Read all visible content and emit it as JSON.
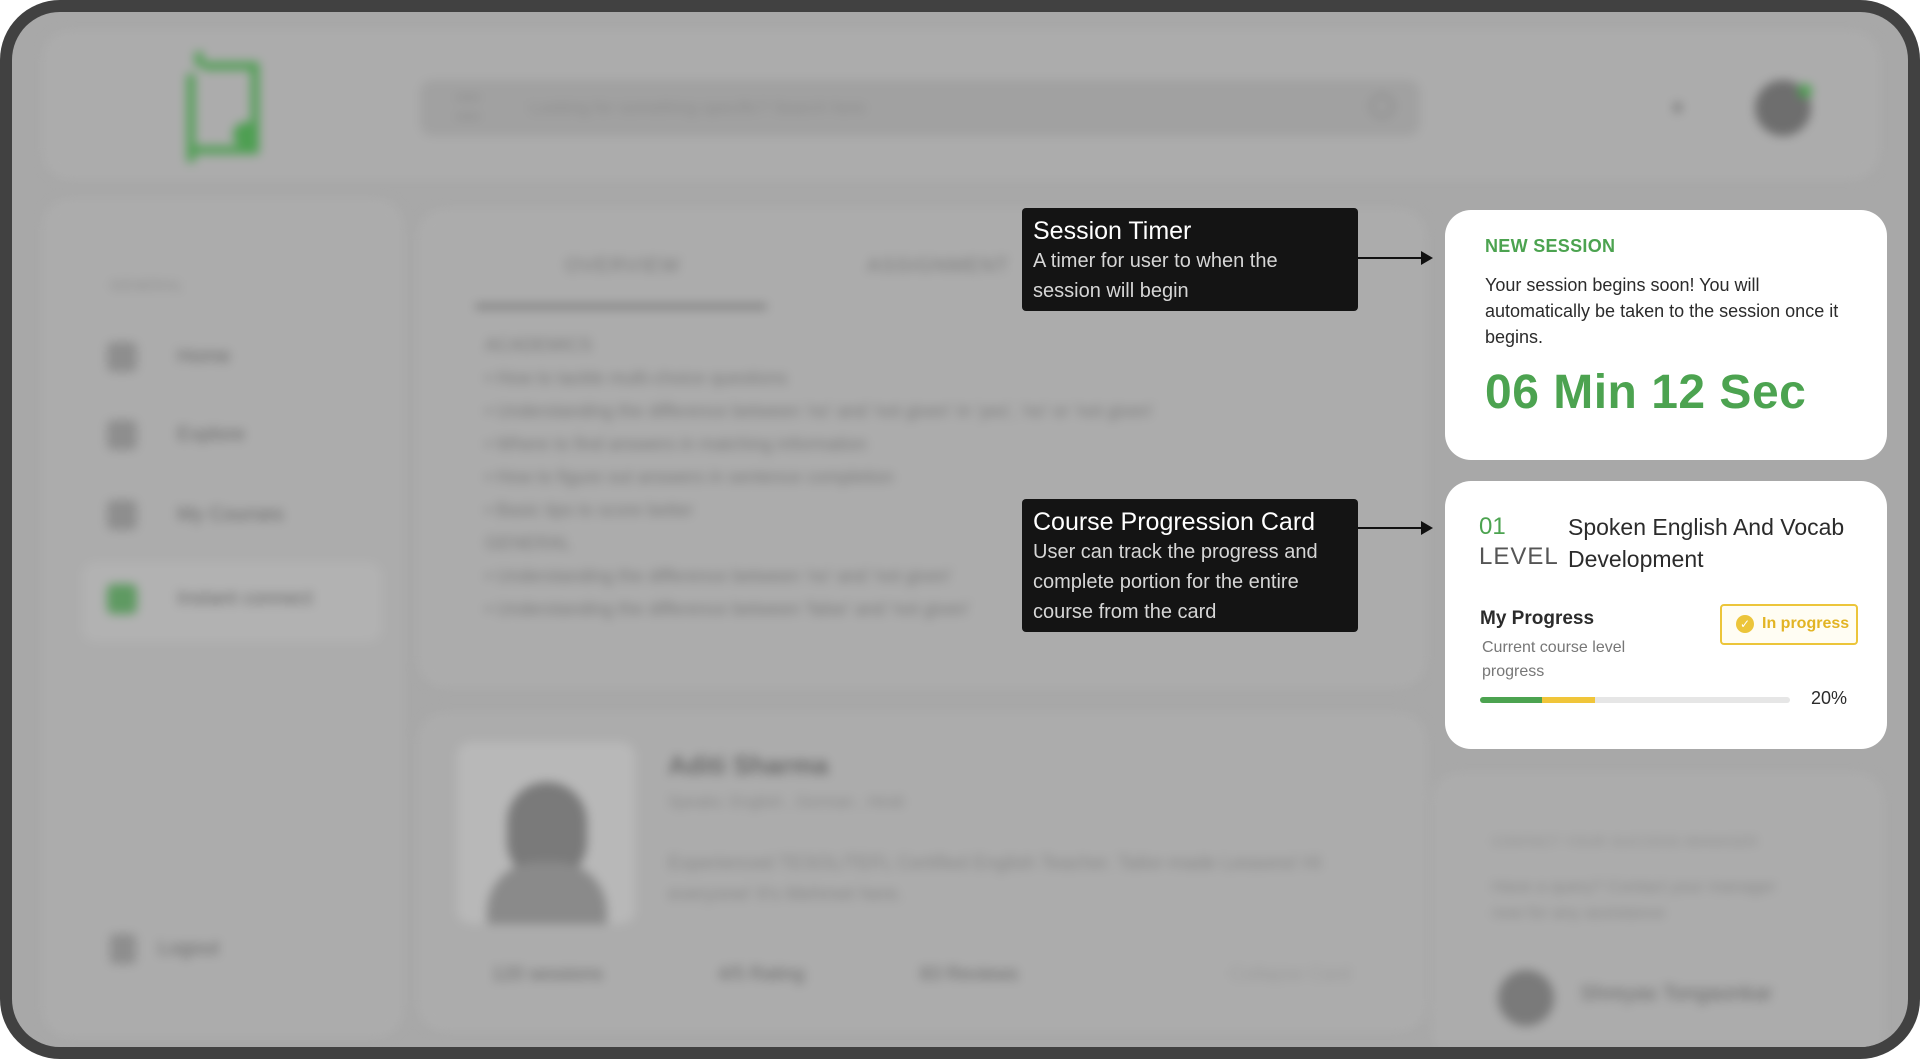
{
  "search": {
    "placeholder": "Looking for something specific? Search here"
  },
  "sidebar": {
    "section_label": "GENERAL",
    "items": [
      {
        "label": "Home"
      },
      {
        "label": "Explore"
      },
      {
        "label": "My Courses"
      },
      {
        "label": "Instant connect"
      }
    ],
    "logout": "Logout"
  },
  "main": {
    "tabs": [
      {
        "label": "OVERVIEW"
      },
      {
        "label": "ASSIGNMENT"
      }
    ],
    "content": [
      "ACADEMICS",
      "• How to tackle multi-choice questions",
      "• Understanding the difference between 'no' and 'not given' in 'yes', 'no' or 'not given'",
      "• Where to find answers in matching information",
      "• How to figure out answers in sentence completion",
      "• Basic tips to score better",
      "GENERAL",
      "• Understanding the difference between 'no' and 'not given'",
      "• Understanding the difference between 'false' and 'not given'"
    ]
  },
  "tutor": {
    "name": "Aditi Sharma",
    "speaks": "Speaks: English , German , Hindi",
    "bio": "Experienced TESOL/TEFL Certified English Teacher. Tailor-made Lessons! Hi everyone! It's Mehmet here.",
    "sessions": "120 sessions",
    "rating": "4/5 Rating",
    "reviews": "83 Reviews",
    "collapse": "Collapse Card"
  },
  "contact": {
    "heading": "CONTACT YOUR SUCCESS MANAGER",
    "text": "Have a query? Contact your manager now for any assistance",
    "manager_name": "Shreyas Tongaonkar"
  },
  "annotations": {
    "session_timer": {
      "title": "Session Timer",
      "description": "A timer for user to when the session will begin"
    },
    "course_progression": {
      "title": "Course Progression Card",
      "description": "User can track the progress and complete portion for the entire course from the card"
    }
  },
  "session_card": {
    "heading": "NEW SESSION",
    "text": "Your session begins soon! You will automatically be taken to the session once it begins.",
    "timer": "06 Min 12 Sec"
  },
  "progress_card": {
    "level_number": "01",
    "level_label": "LEVEL",
    "course_title": "Spoken English And Vocab Development",
    "progress_label": "My Progress",
    "progress_sub": "Current course level progress",
    "status": "In progress",
    "percent_text": "20%",
    "progress_fraction": 0.2,
    "segments": [
      {
        "name": "completed",
        "fraction": 0.2,
        "color": "#4ca350"
      },
      {
        "name": "current",
        "fraction": 0.17,
        "color": "#f0c53a"
      }
    ]
  },
  "colors": {
    "accent": "#4ca350",
    "status_yellow": "#ecc53a",
    "overlay_gray": "#a8a8a8"
  }
}
